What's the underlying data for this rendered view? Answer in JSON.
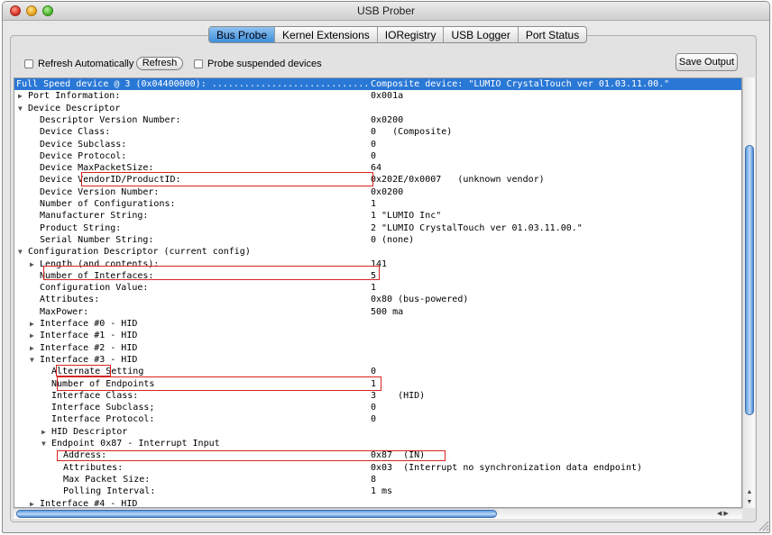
{
  "window": {
    "title": "USB Prober"
  },
  "tabs": [
    {
      "label": "Bus Probe",
      "active": true
    },
    {
      "label": "Kernel Extensions"
    },
    {
      "label": "IORegistry"
    },
    {
      "label": "USB Logger"
    },
    {
      "label": "Port Status"
    }
  ],
  "toolbar": {
    "refresh_auto_label": "Refresh Automatically",
    "refresh_label": "Refresh",
    "probe_suspended_label": "Probe suspended devices",
    "save_output_label": "Save Output"
  },
  "colors": {
    "selection": "#2a78d6",
    "highlight_box": "#d8241f"
  },
  "lines": [
    {
      "tri": "down",
      "key": "Full Speed device @ 3 (0x04400000): .............................",
      "val": "Composite device: \"LUMIO CrystalTouch ver 01.03.11.00.\"",
      "selected": true
    },
    {
      "tri": "right",
      "key": "Port Information:",
      "val": "0x001a"
    },
    {
      "tri": "down",
      "key": "Device Descriptor",
      "val": ""
    },
    {
      "key": "Descriptor Version Number:",
      "val": "0x0200"
    },
    {
      "key": "Device Class:",
      "val": "0   (Composite)"
    },
    {
      "key": "Device Subclass:",
      "val": "0"
    },
    {
      "key": "Device Protocol:",
      "val": "0"
    },
    {
      "key": "Device MaxPacketSize:",
      "val": "64"
    },
    {
      "key": "Device VendorID/ProductID:",
      "val": "0x202E/0x0007   (unknown vendor)"
    },
    {
      "key": "Device Version Number:",
      "val": "0x0200"
    },
    {
      "key": "Number of Configurations:",
      "val": "1"
    },
    {
      "key": "Manufacturer String:",
      "val": "1 \"LUMIO Inc\""
    },
    {
      "key": "Product String:",
      "val": "2 \"LUMIO CrystalTouch ver 01.03.11.00.\""
    },
    {
      "key": "Serial Number String:",
      "val": "0 (none)"
    },
    {
      "tri": "down",
      "key": "Configuration Descriptor (current config)",
      "val": ""
    },
    {
      "tri": "right",
      "key": "Length (and contents):",
      "val": "141"
    },
    {
      "key": "Number of Interfaces:",
      "val": "5"
    },
    {
      "key": "Configuration Value:",
      "val": "1"
    },
    {
      "key": "Attributes:",
      "val": "0x80 (bus-powered)"
    },
    {
      "key": "MaxPower:",
      "val": "500 ma"
    },
    {
      "tri": "right",
      "key": "Interface #0 - HID",
      "val": ""
    },
    {
      "tri": "right",
      "key": "Interface #1 - HID",
      "val": ""
    },
    {
      "tri": "right",
      "key": "Interface #2 - HID",
      "val": ""
    },
    {
      "tri": "down",
      "key": "Interface #3 - HID",
      "val": ""
    },
    {
      "key": "Alternate Setting",
      "val": "0"
    },
    {
      "key": "Number of Endpoints",
      "val": "1"
    },
    {
      "key": "Interface Class:",
      "val": "3    (HID)"
    },
    {
      "key": "Interface Subclass;",
      "val": "0"
    },
    {
      "key": "Interface Protocol:",
      "val": "0"
    },
    {
      "tri": "right",
      "key": "HID Descriptor",
      "val": ""
    },
    {
      "tri": "down",
      "key": "Endpoint 0x87 - Interrupt Input",
      "val": ""
    },
    {
      "key": "Address:",
      "val": "0x87  (IN)"
    },
    {
      "key": "Attributes:",
      "val": "0x03  (Interrupt no synchronization data endpoint)"
    },
    {
      "key": "Max Packet Size:",
      "val": "8"
    },
    {
      "key": "Polling Interval:",
      "val": "1 ms"
    },
    {
      "tri": "right",
      "key": "Interface #4 - HID",
      "val": ""
    }
  ]
}
